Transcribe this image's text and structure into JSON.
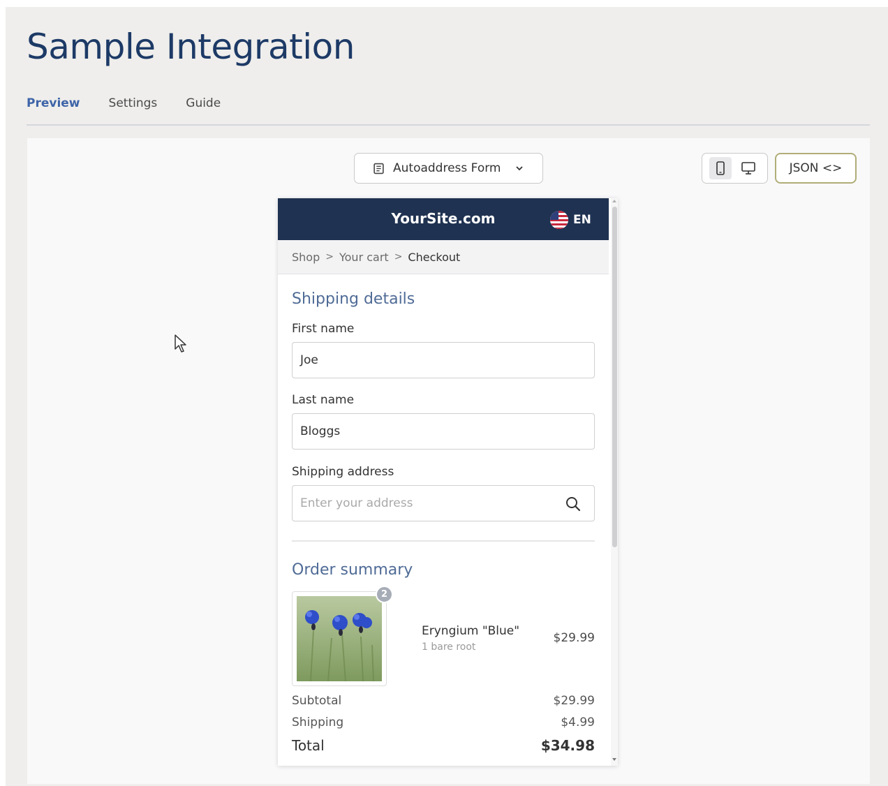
{
  "app": {
    "title": "Sample Integration",
    "tabs": [
      {
        "label": "Preview",
        "active": true
      },
      {
        "label": "Settings",
        "active": false
      },
      {
        "label": "Guide",
        "active": false
      }
    ]
  },
  "toolbar": {
    "form_selector": {
      "label": "Autoaddress Form",
      "icon": "document-icon"
    },
    "device_toggle": [
      {
        "icon": "mobile-icon",
        "active": true
      },
      {
        "icon": "desktop-icon",
        "active": false
      }
    ],
    "json_button": "JSON <>"
  },
  "preview": {
    "site_name": "YourSite.com",
    "language": "EN",
    "breadcrumb": [
      "Shop",
      "Your cart",
      "Checkout"
    ],
    "shipping": {
      "title": "Shipping details",
      "first_name": {
        "label": "First name",
        "value": "Joe"
      },
      "last_name": {
        "label": "Last name",
        "value": "Bloggs"
      },
      "address": {
        "label": "Shipping address",
        "placeholder": "Enter your address"
      }
    },
    "order": {
      "title": "Order summary",
      "items": [
        {
          "name": "Eryngium \"Blue\"",
          "variant": "1 bare root",
          "price": "$29.99",
          "quantity": "2"
        }
      ],
      "subtotal_label": "Subtotal",
      "subtotal": "$29.99",
      "shipping_label": "Shipping",
      "shipping": "$4.99",
      "total_label": "Total",
      "total": "$34.98"
    }
  },
  "colors": {
    "title": "#1d3a66",
    "active_tab": "#3e64a8",
    "site_header": "#1f3251",
    "section_title": "#4f6b96",
    "json_border": "#b0ad78"
  }
}
